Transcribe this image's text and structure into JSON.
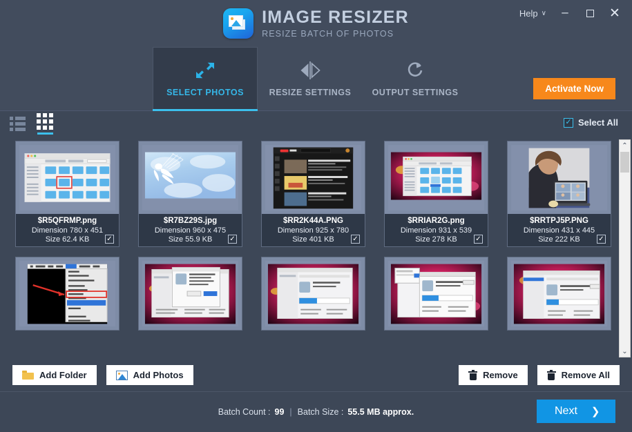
{
  "window": {
    "help_label": "Help",
    "chevron": "∨",
    "minimize": "–",
    "maximize": "□",
    "close": "✕"
  },
  "brand": {
    "title": "IMAGE RESIZER",
    "subtitle": "RESIZE BATCH OF PHOTOS",
    "icon": "image-resizer-app-icon"
  },
  "tabs": [
    {
      "label": "SELECT PHOTOS",
      "icon": "resize-arrows-icon",
      "active": true
    },
    {
      "label": "RESIZE SETTINGS",
      "icon": "mirror-flip-icon",
      "active": false
    },
    {
      "label": "OUTPUT SETTINGS",
      "icon": "rotate-refresh-icon",
      "active": false
    }
  ],
  "activate": {
    "label": "Activate Now",
    "color": "#f7881b"
  },
  "viewbar": {
    "list_view_icon": "list-view-icon",
    "grid_view_icon": "grid-view-icon",
    "active_view": "grid",
    "select_all_label": "Select All",
    "select_all_checked": true,
    "check_glyph": "✓"
  },
  "photos": [
    {
      "name": "$R5QFRMP.png",
      "dimension": "Dimension 780 x 451",
      "size": "Size 62.4 KB",
      "checked": true,
      "thumb": "finder-window-light"
    },
    {
      "name": "$R7BZ29S.jpg",
      "dimension": "Dimension 960 x 475",
      "size": "Size 55.9 KB",
      "checked": true,
      "thumb": "sky-fairy-watercolor"
    },
    {
      "name": "$RR2K44A.PNG",
      "dimension": "Dimension 925 x 780",
      "size": "Size 401 KB",
      "checked": true,
      "thumb": "youtube-dark-results"
    },
    {
      "name": "$RRIAR2G.png",
      "dimension": "Dimension 931 x 539",
      "size": "Size 278 KB",
      "checked": true,
      "thumb": "finder-pink-wallpaper"
    },
    {
      "name": "$RRTPJ5P.PNG",
      "dimension": "Dimension 431 x 445",
      "size": "Size 222 KB",
      "checked": true,
      "thumb": "woman-video-call"
    },
    {
      "name": "",
      "dimension": "",
      "size": "",
      "checked": false,
      "thumb": "mac-menu-red-arrow"
    },
    {
      "name": "",
      "dimension": "",
      "size": "",
      "checked": false,
      "thumb": "installer-dialog-pink"
    },
    {
      "name": "",
      "dimension": "",
      "size": "",
      "checked": false,
      "thumb": "installer-window-pink"
    },
    {
      "name": "",
      "dimension": "",
      "size": "",
      "checked": false,
      "thumb": "installer-progress-pink"
    },
    {
      "name": "",
      "dimension": "",
      "size": "",
      "checked": false,
      "thumb": "installer-detail-pink"
    }
  ],
  "scrollbar": {
    "up": "⌃",
    "down": "⌄"
  },
  "actions": {
    "add_folder": "Add Folder",
    "add_photos": "Add Photos",
    "remove": "Remove",
    "remove_all": "Remove All"
  },
  "footer": {
    "batch_count_label": "Batch Count :",
    "batch_count_value": "99",
    "separator": "|",
    "batch_size_label": "Batch Size :",
    "batch_size_value": "55.5 MB approx.",
    "next_label": "Next",
    "next_arrow": "❯"
  }
}
